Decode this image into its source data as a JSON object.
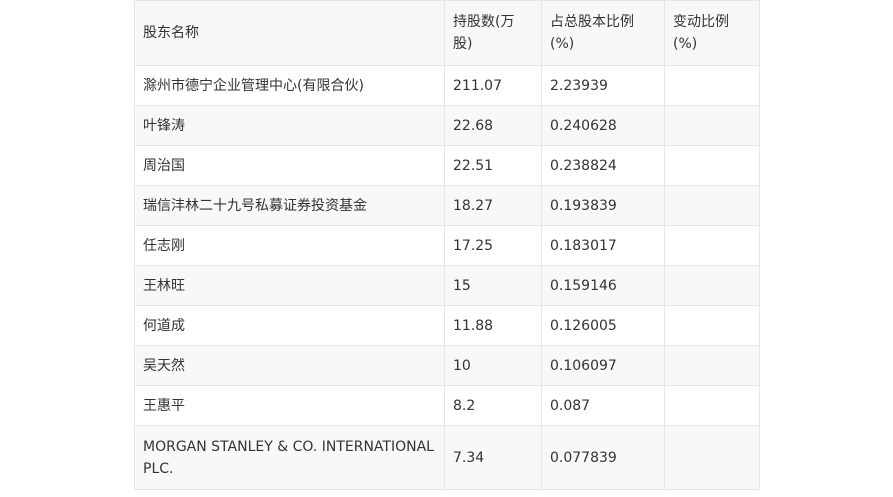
{
  "table": {
    "headers": [
      "股东名称",
      "持股数(万股)",
      "占总股本比例(%)",
      "变动比例(%)"
    ],
    "rows": [
      {
        "name": "滁州市德宁企业管理中心(有限合伙)",
        "shares": "211.07",
        "ratio": "2.23939",
        "change": ""
      },
      {
        "name": "叶锋涛",
        "shares": "22.68",
        "ratio": "0.240628",
        "change": ""
      },
      {
        "name": "周治国",
        "shares": "22.51",
        "ratio": "0.238824",
        "change": ""
      },
      {
        "name": "瑞信沣林二十九号私募证券投资基金",
        "shares": "18.27",
        "ratio": "0.193839",
        "change": ""
      },
      {
        "name": "任志刚",
        "shares": "17.25",
        "ratio": "0.183017",
        "change": ""
      },
      {
        "name": "王林旺",
        "shares": "15",
        "ratio": "0.159146",
        "change": ""
      },
      {
        "name": "何道成",
        "shares": "11.88",
        "ratio": "0.126005",
        "change": ""
      },
      {
        "name": "吴天然",
        "shares": "10",
        "ratio": "0.106097",
        "change": ""
      },
      {
        "name": "王惠平",
        "shares": "8.2",
        "ratio": "0.087",
        "change": ""
      },
      {
        "name": "MORGAN STANLEY & CO. INTERNATIONAL PLC.",
        "shares": "7.34",
        "ratio": "0.077839",
        "change": ""
      }
    ]
  }
}
